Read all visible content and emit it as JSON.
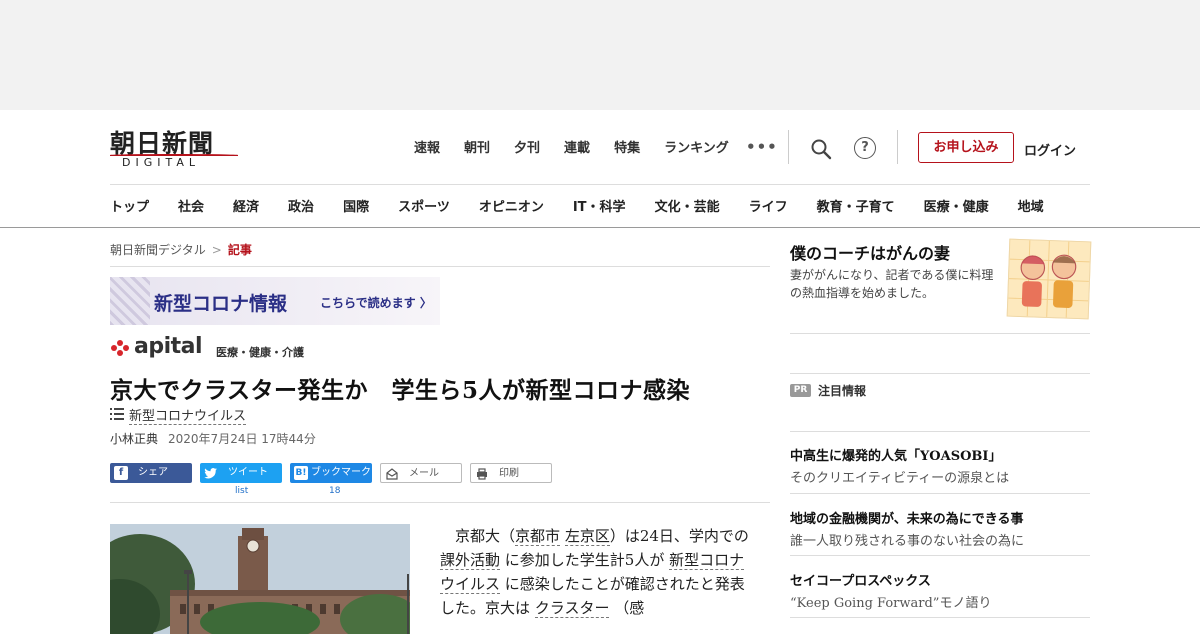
{
  "header": {
    "logo_main": "朝日新聞",
    "logo_sub": "DIGITAL",
    "top_nav": [
      "速報",
      "朝刊",
      "夕刊",
      "連載",
      "特集",
      "ランキング"
    ],
    "more_label": "•••",
    "help_label": "?",
    "apply_label": "お申し込み",
    "login_label": "ログイン",
    "categories": [
      "トップ",
      "社会",
      "経済",
      "政治",
      "国際",
      "スポーツ",
      "オピニオン",
      "IT・科学",
      "文化・芸能",
      "ライフ",
      "教育・子育て",
      "医療・健康",
      "地域"
    ]
  },
  "breadcrumb": {
    "home": "朝日新聞デジタル",
    "separator": ">",
    "current": "記事"
  },
  "banner": {
    "title": "新型コロナ情報",
    "link": "こちらで読めます 〉"
  },
  "apital": {
    "brand": "apital",
    "category": "医療・健康・介護"
  },
  "article": {
    "headline": "京大でクラスター発生か　学生ら5人が新型コロナ感染",
    "tag": "新型コロナウイルス",
    "author": "小林正典",
    "date": "2020年7月24日 17時44分",
    "body": {
      "p1": "京都大（",
      "kw1": "京都市",
      "p2": " ",
      "kw2": "左京区",
      "p3": "）は24日、学内での ",
      "kw3": "課外活動",
      "p4": " に参加した学生計5人が ",
      "kw4": "新型コロナウイルス",
      "p5": " に感染したことが確認されたと発表した。京大は ",
      "kw5": "クラスター",
      "p6": " （感"
    }
  },
  "share": {
    "facebook": "シェア",
    "twitter": "ツイート",
    "twitter_count": "list",
    "hatena": "ブックマーク",
    "hatena_count": "18",
    "mail": "メール",
    "print": "印刷"
  },
  "sidebar": {
    "feature_title": "僕のコーチはがんの妻",
    "feature_desc": "妻ががんになり、記者である僕に料理の熱血指導を始めました。",
    "pr_badge": "PR",
    "pr_label": "注目情報",
    "pr_items": [
      {
        "title": "中高生に爆発的人気「YOASOBI」",
        "sub": "そのクリエイティビティーの源泉とは"
      },
      {
        "title": "地域の金融機関が、未来の為にできる事",
        "sub": "誰一人取り残される事のない社会の為に"
      },
      {
        "title": "セイコープロスペックス",
        "sub": "“Keep Going Forward”モノ語り"
      }
    ]
  },
  "colors": {
    "brand_red": "#b5121b",
    "facebook": "#3b5998",
    "twitter": "#1da1f2",
    "hatena": "#1e88e5",
    "corona_navy": "#2b2f86"
  }
}
